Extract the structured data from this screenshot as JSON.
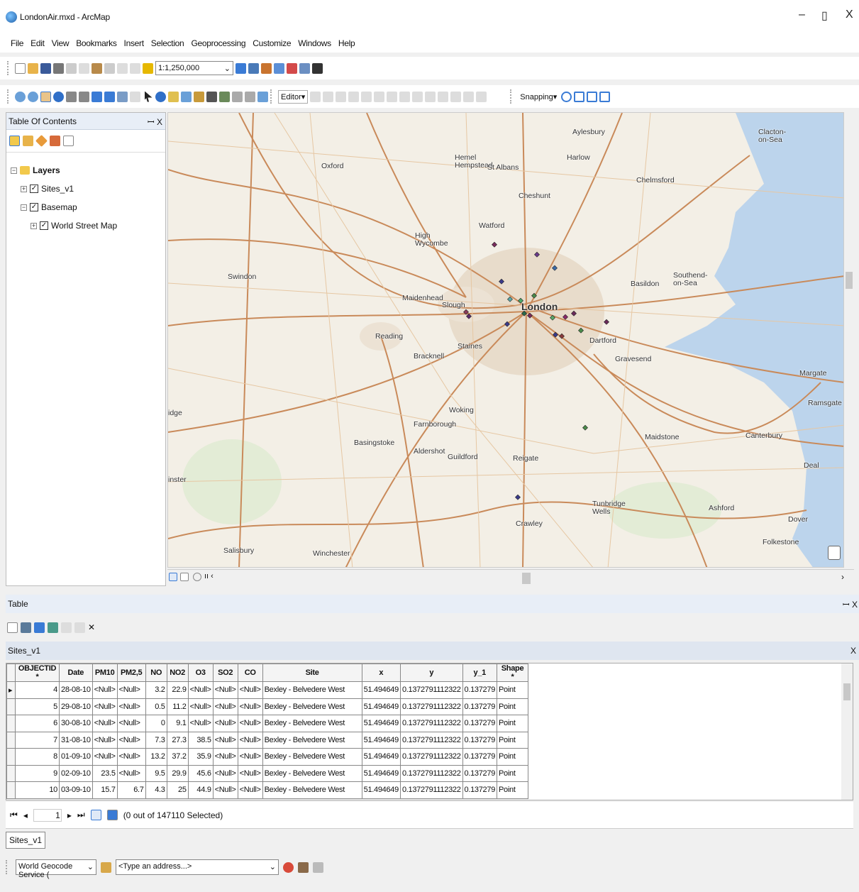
{
  "window": {
    "title": "LondonAir.mxd - ArcMap",
    "minimize": "–",
    "restore": "▯",
    "close": "X"
  },
  "menu": [
    "File",
    "Edit",
    "View",
    "Bookmarks",
    "Insert",
    "Selection",
    "Geoprocessing",
    "Customize",
    "Windows",
    "Help"
  ],
  "toolbar": {
    "scale": "1:1,250,000",
    "editor": "Editor▾",
    "snapping": "Snapping▾"
  },
  "toc": {
    "title": "Table Of Contents",
    "pin": "ꟷ X",
    "layers": "Layers",
    "sites": "Sites_v1",
    "basemap": "Basemap",
    "world_street": "World Street Map"
  },
  "map": {
    "labels": [
      [
        "Aylesbury",
        570,
        22
      ],
      [
        "Hemel\nHempstead",
        404,
        58
      ],
      [
        "St Albans",
        450,
        72
      ],
      [
        "Harlow",
        562,
        58
      ],
      [
        "Clacton-\non-Sea",
        832,
        22
      ],
      [
        "Oxford",
        216,
        70
      ],
      [
        "Chelmsford",
        660,
        90
      ],
      [
        "Cheshunt",
        494,
        112
      ],
      [
        "Watford",
        438,
        154
      ],
      [
        "High\nWycombe",
        348,
        168
      ],
      [
        "Swindon",
        84,
        226
      ],
      [
        "Maidenhead",
        330,
        256
      ],
      [
        "Slough",
        386,
        266
      ],
      [
        "London",
        498,
        268
      ],
      [
        "Basildon",
        652,
        236
      ],
      [
        "Southend-\non-Sea",
        712,
        224
      ],
      [
        "Reading",
        292,
        310
      ],
      [
        "Staines",
        408,
        324
      ],
      [
        "Bracknell",
        346,
        338
      ],
      [
        "Dartford",
        594,
        316
      ],
      [
        "Gravesend",
        630,
        342
      ],
      [
        "Margate",
        890,
        362
      ],
      [
        "Ramsgate",
        902,
        404
      ],
      [
        "idge",
        0,
        418
      ],
      [
        "Woking",
        396,
        414
      ],
      [
        "Farnborough",
        346,
        434
      ],
      [
        "Basingstoke",
        262,
        460
      ],
      [
        "Maidstone",
        672,
        452
      ],
      [
        "Canterbury",
        814,
        450
      ],
      [
        "Aldershot",
        346,
        472
      ],
      [
        "Guildford",
        394,
        480
      ],
      [
        "Reigate",
        486,
        482
      ],
      [
        "Deal",
        896,
        492
      ],
      [
        "inster",
        0,
        512
      ],
      [
        "Tunbridge\nWells",
        598,
        546
      ],
      [
        "Ashford",
        762,
        552
      ],
      [
        "Crawley",
        490,
        574
      ],
      [
        "Dover",
        874,
        568
      ],
      [
        "Folkestone",
        838,
        600
      ],
      [
        "Salisbury",
        78,
        612
      ],
      [
        "Winchester",
        204,
        616
      ]
    ]
  },
  "table": {
    "panel_title": "Table",
    "panel_pin": "ꟷ X",
    "layer_name": "Sites_v1",
    "close": "X",
    "columns": [
      "OBJECTID *",
      "Date",
      "PM10",
      "PM2,5",
      "NO",
      "NO2",
      "O3",
      "SO2",
      "CO",
      "Site",
      "x",
      "y",
      "y_1",
      "Shape *"
    ],
    "rows": [
      [
        "4",
        "28-08-10",
        "<Null>",
        "<Null>",
        "3.2",
        "22.9",
        "<Null>",
        "<Null>",
        "<Null>",
        "Bexley - Belvedere West",
        "51.494649",
        "0.1372791112322",
        "0.137279",
        "Point"
      ],
      [
        "5",
        "29-08-10",
        "<Null>",
        "<Null>",
        "0.5",
        "11.2",
        "<Null>",
        "<Null>",
        "<Null>",
        "Bexley - Belvedere West",
        "51.494649",
        "0.1372791112322",
        "0.137279",
        "Point"
      ],
      [
        "6",
        "30-08-10",
        "<Null>",
        "<Null>",
        "0",
        "9.1",
        "<Null>",
        "<Null>",
        "<Null>",
        "Bexley - Belvedere West",
        "51.494649",
        "0.1372791112322",
        "0.137279",
        "Point"
      ],
      [
        "7",
        "31-08-10",
        "<Null>",
        "<Null>",
        "7.3",
        "27.3",
        "38.5",
        "<Null>",
        "<Null>",
        "Bexley - Belvedere West",
        "51.494649",
        "0.1372791112322",
        "0.137279",
        "Point"
      ],
      [
        "8",
        "01-09-10",
        "<Null>",
        "<Null>",
        "13.2",
        "37.2",
        "35.9",
        "<Null>",
        "<Null>",
        "Bexley - Belvedere West",
        "51.494649",
        "0.1372791112322",
        "0.137279",
        "Point"
      ],
      [
        "9",
        "02-09-10",
        "23.5",
        "<Null>",
        "9.5",
        "29.9",
        "45.6",
        "<Null>",
        "<Null>",
        "Bexley - Belvedere West",
        "51.494649",
        "0.1372791112322",
        "0.137279",
        "Point"
      ],
      [
        "10",
        "03-09-10",
        "15.7",
        "6.7",
        "4.3",
        "25",
        "44.9",
        "<Null>",
        "<Null>",
        "Bexley - Belvedere West",
        "51.494649",
        "0.1372791112322",
        "0.137279",
        "Point"
      ]
    ],
    "nav_record": "1",
    "selection_status": "(0 out of 147110 Selected)",
    "sheet_tab": "Sites_v1"
  },
  "geocode": {
    "service": "World Geocode Service (",
    "address_placeholder": "<Type an address...>"
  }
}
